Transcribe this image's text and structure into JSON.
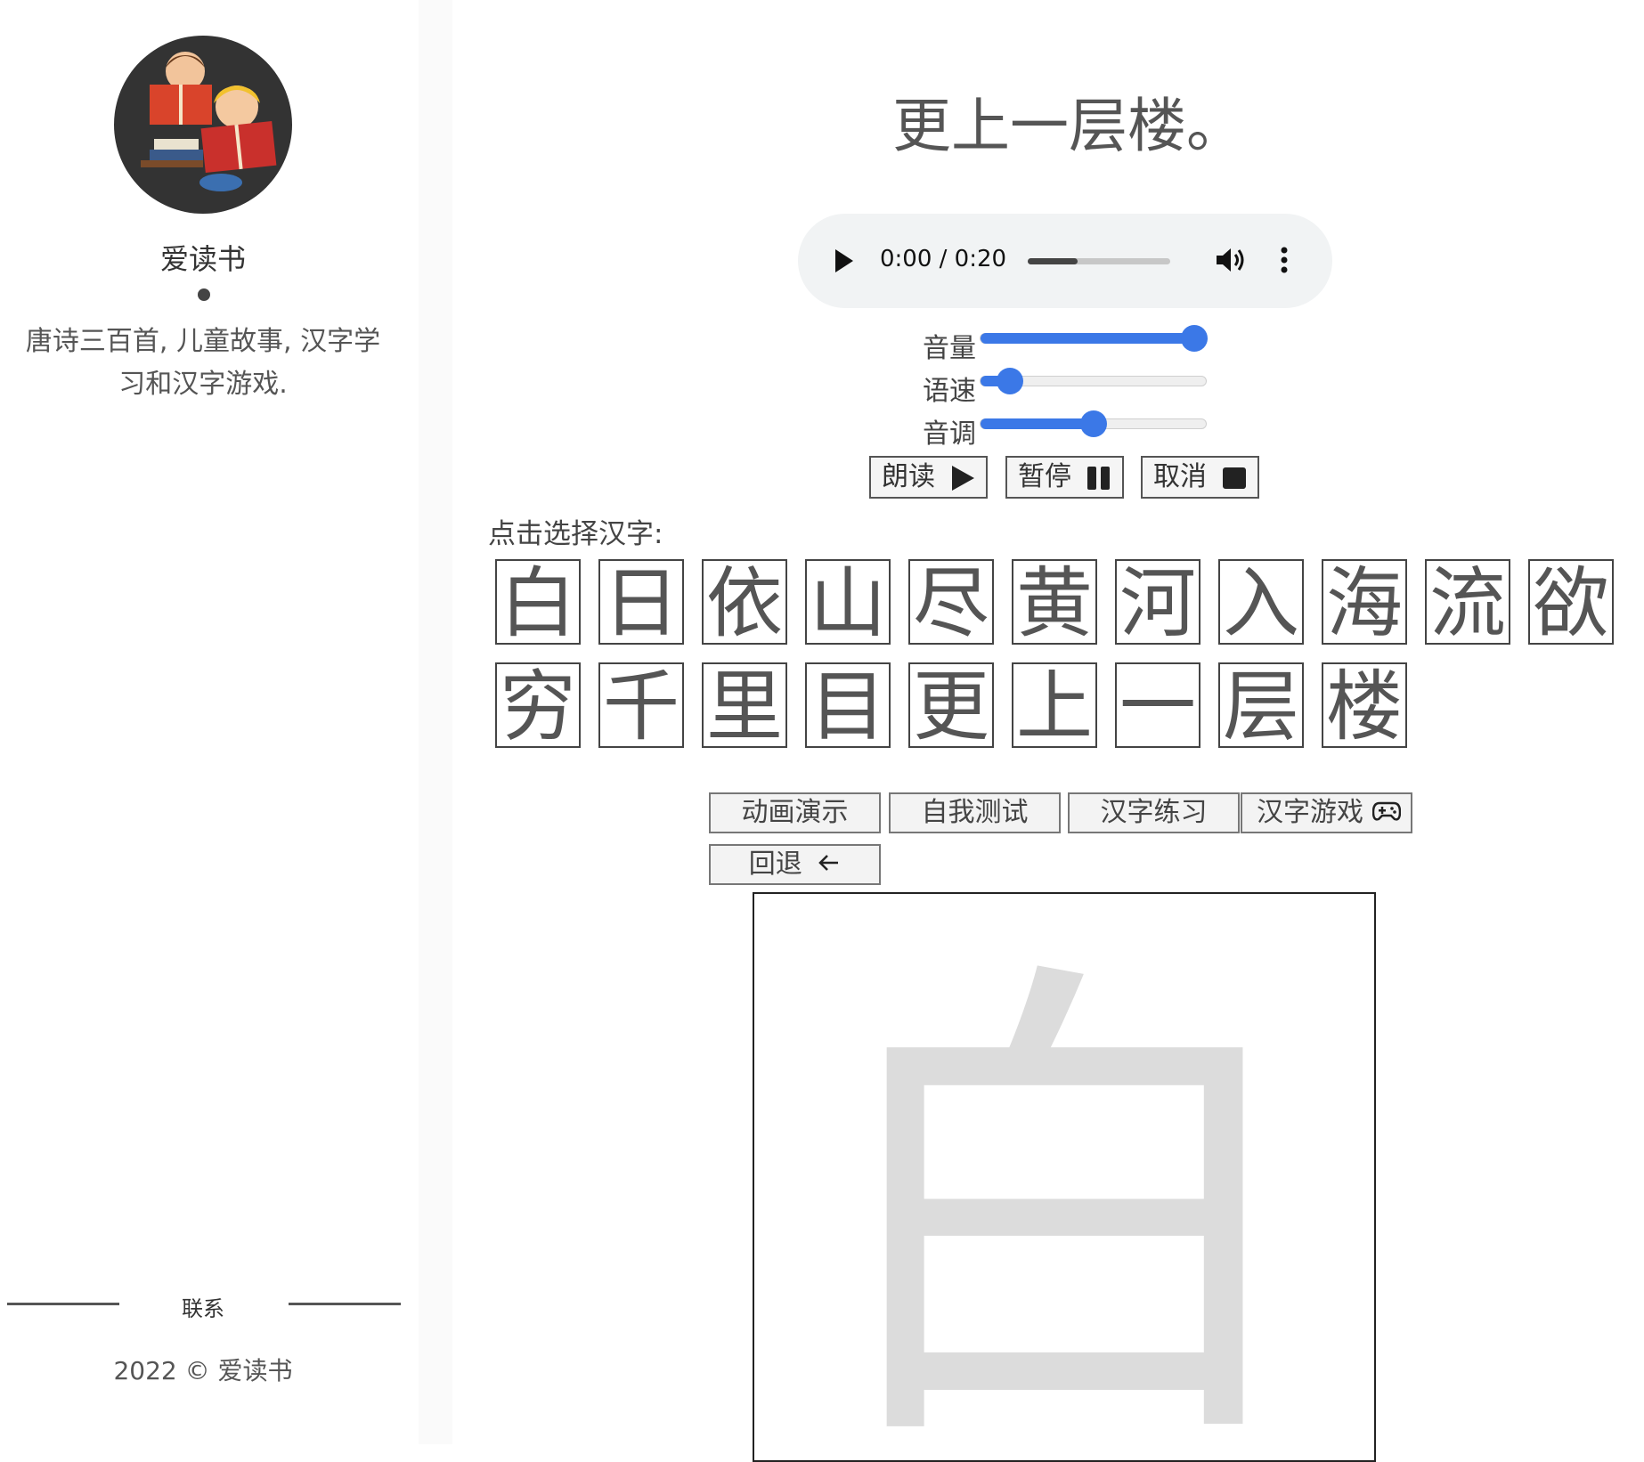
{
  "sidebar": {
    "site_name": "爱读书",
    "description": "唐诗三百首, 儿童故事, 汉字学习和汉字游戏.",
    "contact_label": "联系",
    "copyright": "2022 © 爱读书"
  },
  "poem": {
    "title": "更上一层楼。"
  },
  "audio_player": {
    "time": "0:00 / 0:20",
    "progress_fraction": 0.35
  },
  "speech": {
    "sliders": [
      {
        "label": "音量",
        "value_fraction": 0.95
      },
      {
        "label": "语速",
        "value_fraction": 0.13
      },
      {
        "label": "音调",
        "value_fraction": 0.5
      }
    ],
    "buttons": {
      "read": "朗读",
      "pause": "暂停",
      "cancel": "取消"
    }
  },
  "characters": {
    "prompt": "点击选择汉字:",
    "row1": [
      "白",
      "日",
      "依",
      "山",
      "尽",
      "黄",
      "河",
      "入",
      "海",
      "流",
      "欲"
    ],
    "row2": [
      "穷",
      "千",
      "里",
      "目",
      "更",
      "上",
      "一",
      "层",
      "楼"
    ]
  },
  "actions": {
    "animation": "动画演示",
    "self_test": "自我测试",
    "practice": "汉字练习",
    "game": "汉字游戏",
    "back": "回退"
  },
  "canvas": {
    "character": "白"
  },
  "colors": {
    "slider_accent": "#3b78e7",
    "sidebar_bg": "#ffffff",
    "gutter_bg": "#fafafa"
  }
}
